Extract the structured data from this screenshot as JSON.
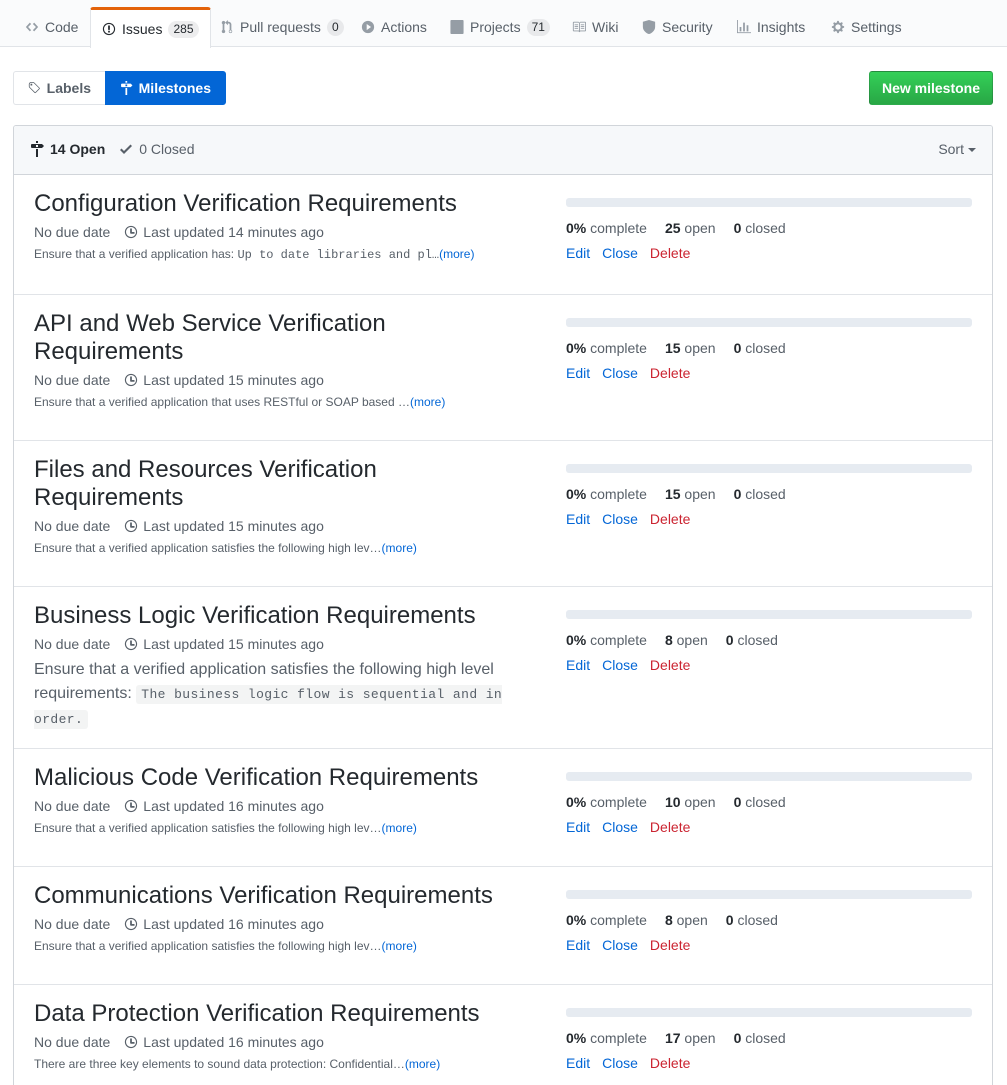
{
  "repo_nav": {
    "tabs": [
      {
        "label": "Code",
        "icon": "code-icon"
      },
      {
        "label": "Issues",
        "count": "285",
        "icon": "issue-opened-icon",
        "selected": true
      },
      {
        "label": "Pull requests",
        "count": "0",
        "icon": "git-pull-request-icon"
      },
      {
        "label": "Actions",
        "icon": "play-icon"
      },
      {
        "label": "Projects",
        "count": "71",
        "icon": "project-icon"
      },
      {
        "label": "Wiki",
        "icon": "book-icon"
      },
      {
        "label": "Security",
        "icon": "shield-icon"
      },
      {
        "label": "Insights",
        "icon": "graph-icon"
      },
      {
        "label": "Settings",
        "icon": "gear-icon"
      }
    ]
  },
  "subnav": {
    "labels": "Labels",
    "milestones": "Milestones",
    "new_milestone": "New milestone"
  },
  "header": {
    "open": "14 Open",
    "closed": "0 Closed",
    "sort": "Sort"
  },
  "colors": {
    "accent": "#0366d6",
    "danger": "#cb2431",
    "green": "#28a745",
    "active_tab": "#e36209"
  },
  "milestones": [
    {
      "title": "Configuration Verification Requirements",
      "due": "No due date",
      "updated": "Last updated 14 minutes ago",
      "desc_text": "Ensure that a verified application has: ",
      "desc_code": "Up to date libraries and pl…",
      "more": "(more)",
      "complete_pct": "0%",
      "complete_label": "complete",
      "open_count": "25",
      "open_label": "open",
      "closed_count": "0",
      "closed_label": "closed",
      "edit": "Edit",
      "close": "Close",
      "delete": "Delete"
    },
    {
      "title": "API and Web Service Verification Requirements",
      "due": "No due date",
      "updated": "Last updated 15 minutes ago",
      "desc_text": "Ensure that a verified application that uses RESTful or SOAP based …",
      "more": "(more)",
      "complete_pct": "0%",
      "complete_label": "complete",
      "open_count": "15",
      "open_label": "open",
      "closed_count": "0",
      "closed_label": "closed",
      "edit": "Edit",
      "close": "Close",
      "delete": "Delete"
    },
    {
      "title": "Files and Resources Verification Requirements",
      "due": "No due date",
      "updated": "Last updated 15 minutes ago",
      "desc_text": "Ensure that a verified application satisfies the following high lev…",
      "more": "(more)",
      "complete_pct": "0%",
      "complete_label": "complete",
      "open_count": "15",
      "open_label": "open",
      "closed_count": "0",
      "closed_label": "closed",
      "edit": "Edit",
      "close": "Close",
      "delete": "Delete"
    },
    {
      "title": "Business Logic Verification Requirements",
      "due": "No due date",
      "updated": "Last updated 15 minutes ago",
      "desc_text": "Ensure that a verified application satisfies the following high level requirements: ",
      "desc_code": "The business logic flow is sequential and in order.",
      "complete_pct": "0%",
      "complete_label": "complete",
      "open_count": "8",
      "open_label": "open",
      "closed_count": "0",
      "closed_label": "closed",
      "edit": "Edit",
      "close": "Close",
      "delete": "Delete"
    },
    {
      "title": "Malicious Code Verification Requirements",
      "due": "No due date",
      "updated": "Last updated 16 minutes ago",
      "desc_text": "Ensure that a verified application satisfies the following high lev…",
      "more": "(more)",
      "complete_pct": "0%",
      "complete_label": "complete",
      "open_count": "10",
      "open_label": "open",
      "closed_count": "0",
      "closed_label": "closed",
      "edit": "Edit",
      "close": "Close",
      "delete": "Delete"
    },
    {
      "title": "Communications Verification Requirements",
      "due": "No due date",
      "updated": "Last updated 16 minutes ago",
      "desc_text": "Ensure that a verified application satisfies the following high lev…",
      "more": "(more)",
      "complete_pct": "0%",
      "complete_label": "complete",
      "open_count": "8",
      "open_label": "open",
      "closed_count": "0",
      "closed_label": "closed",
      "edit": "Edit",
      "close": "Close",
      "delete": "Delete"
    },
    {
      "title": "Data Protection Verification Requirements",
      "due": "No due date",
      "updated": "Last updated 16 minutes ago",
      "desc_text": "There are three key elements to sound data protection: Confidential…",
      "more": "(more)",
      "complete_pct": "0%",
      "complete_label": "complete",
      "open_count": "17",
      "open_label": "open",
      "closed_count": "0",
      "closed_label": "closed",
      "edit": "Edit",
      "close": "Close",
      "delete": "Delete"
    }
  ]
}
